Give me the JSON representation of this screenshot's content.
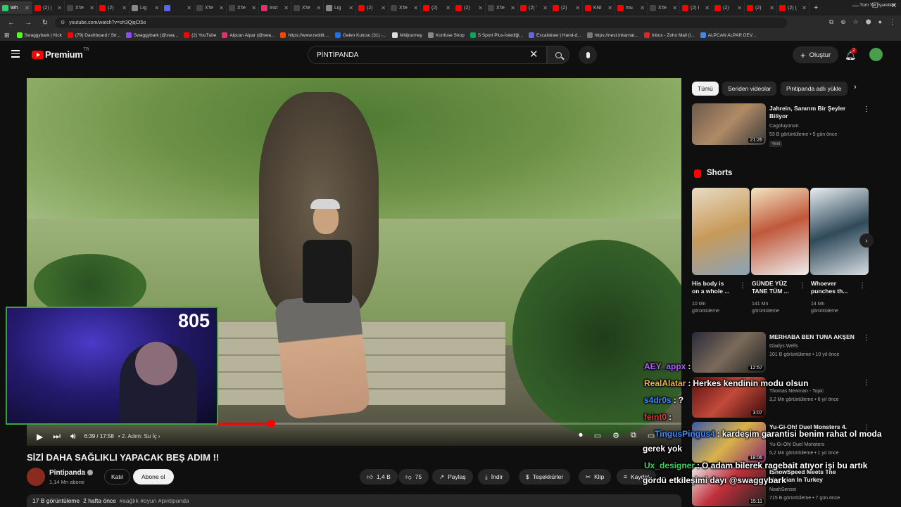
{
  "browser": {
    "tabs": [
      {
        "label": "Wh",
        "color": "#25d366"
      },
      {
        "label": "(2) (",
        "color": "#ff0000"
      },
      {
        "label": "X'te",
        "color": "#444"
      },
      {
        "label": "(2)",
        "color": "#ff0000"
      },
      {
        "label": "Lig",
        "color": "#888"
      },
      {
        "label": "",
        "color": "#5865f2"
      },
      {
        "label": "X'te",
        "color": "#444"
      },
      {
        "label": "X'te",
        "color": "#444"
      },
      {
        "label": "İnst",
        "color": "#e1306c"
      },
      {
        "label": "X'te",
        "color": "#444"
      },
      {
        "label": "Lig",
        "color": "#888"
      },
      {
        "label": "(2)",
        "color": "#ff0000"
      },
      {
        "label": "X'te",
        "color": "#444"
      },
      {
        "label": "(2)",
        "color": "#ff0000"
      },
      {
        "label": "(2)",
        "color": "#ff0000"
      },
      {
        "label": "X'te",
        "color": "#444"
      },
      {
        "label": "(2) '",
        "color": "#ff0000"
      },
      {
        "label": "(2)",
        "color": "#ff0000"
      },
      {
        "label": "KNI",
        "color": "#ff0000"
      },
      {
        "label": "mu",
        "color": "#ff0000"
      },
      {
        "label": "X'te",
        "color": "#444"
      },
      {
        "label": "(2) I",
        "color": "#ff0000"
      },
      {
        "label": "(2)",
        "color": "#ff0000"
      },
      {
        "label": "(2)",
        "color": "#ff0000"
      },
      {
        "label": "(2) (",
        "color": "#ff0000"
      }
    ],
    "new_tab": "+",
    "window_controls": [
      "—",
      "☐",
      "✕"
    ],
    "url": "youtube.com/watch?v=oh3QjqCt5o",
    "bookmarks": [
      {
        "label": "Swaggybark | Kick",
        "color": "#53fc18"
      },
      {
        "label": "(79) Dashboard / Str...",
        "color": "#ff0000"
      },
      {
        "label": "Swaggybark (@swa...",
        "color": "#9146ff"
      },
      {
        "label": "(2) YouTube",
        "color": "#ff0000"
      },
      {
        "label": "Alpcan Alpar (@swa...",
        "color": "#e1306c"
      },
      {
        "label": "https://www.reddit....",
        "color": "#ff4500"
      },
      {
        "label": "Gelen Kutusu (31) -...",
        "color": "#1a73e8"
      },
      {
        "label": "Midjourney",
        "color": "#ddd"
      },
      {
        "label": "Konfuse Shop",
        "color": "#888"
      },
      {
        "label": "S Sport Plus-İstediği...",
        "color": "#0a5"
      },
      {
        "label": "Excalidraw | Hand-d...",
        "color": "#6965db"
      },
      {
        "label": "https://nest.inkarnat...",
        "color": "#777"
      },
      {
        "label": "Inbox - Zoho Mail (i...",
        "color": "#e42527"
      },
      {
        "label": "ALPCAN ALPAR DEV...",
        "color": "#4285f4"
      }
    ],
    "all_bookmarks": "Tüm Yer İşaretleri"
  },
  "header": {
    "brand": "Premium",
    "region": "TR",
    "search_value": "PİNTİPANDA",
    "create_label": "Oluştur",
    "notifications": "2"
  },
  "player": {
    "progress": 0.373,
    "time": "6:39 / 17:58",
    "chapter": "• 2. Adım: Su İç ›"
  },
  "webcam": {
    "count": "805"
  },
  "video": {
    "title": "SİZİ DAHA SAĞLIKLI YAPACAK BEŞ ADIM !!",
    "channel": "Pintipanda",
    "subscribers": "1,14 Mn abone",
    "join_label": "Katıl",
    "subscribe_label": "Abone ol",
    "likes": "1,4 B",
    "dislikes": "75",
    "share_label": "Paylaş",
    "download_label": "İndir",
    "thanks_label": "Teşekkürler",
    "clip_label": "Klip",
    "save_label": "Kaydet",
    "views": "17 B görüntüleme",
    "age": "2 hafta önce",
    "tags": "#sağlık #oyun #pintipanda"
  },
  "sidebar": {
    "chips": [
      "Tümü",
      "Seriden videolar",
      "Pintipanda adlı yükle"
    ],
    "first_video": {
      "title_line1": "Jahrein, Sanırım Bir Şeyler",
      "title_line2": "Biliyor",
      "channel": "Cagoluyorum",
      "meta": "53 B görüntüleme • 5 gün önce",
      "badge": "Yeni",
      "duration": "21:26"
    },
    "shorts_label": "Shorts",
    "shorts": [
      {
        "line1": "His body is",
        "line2": "on a whole ...",
        "views1": "10 Mn",
        "views2": "görüntüleme"
      },
      {
        "line1": "GÜNDE YÜZ",
        "line2": "TANE TÜM ...",
        "views1": "141 Mn",
        "views2": "görüntüleme"
      },
      {
        "line1": "Whoever",
        "line2": "punches th...",
        "views1": "14 Mn",
        "views2": "görüntüleme"
      }
    ],
    "videos": [
      {
        "title": "MERHABA BEN TUNA AKŞEN",
        "channel": "Gladys Wells",
        "meta": "101 B görüntüleme • 10 yıl önce",
        "duration": "12:57"
      },
      {
        "title": "",
        "channel": "Thomas Newman - Topic",
        "meta": "3,2 Mn görüntüleme • 6 yıl önce",
        "duration": "3:07"
      },
      {
        "title": "Yu-Gi-Oh! Duel Monsters 4.",
        "channel": "Yu-Gi-Oh! Duel Monsters",
        "meta": "5,2 Mn görüntüleme • 1 yıl önce",
        "duration": "18:06"
      },
      {
        "title": "IShowSpeed Meets The",
        "subtitle": "Magician In Turkey",
        "channel": "NoahSensei",
        "meta": "715 B görüntüleme • 7 gün önce",
        "duration": "15:11"
      }
    ]
  },
  "chat": [
    {
      "user": "AEY_appx",
      "sep": ":",
      "msg": "",
      "color": "#b45cff"
    },
    {
      "user": "RealAlatar",
      "sep": ":",
      "msg": "Herkes kendinin modu olsun",
      "color": "#f0b24a"
    },
    {
      "user": "s4dr0s",
      "sep": ":",
      "msg": "?",
      "color": "#3d8bff"
    },
    {
      "user": "feint0",
      "sep": ":",
      "msg": "",
      "color": "#e03a3a"
    },
    {
      "user": "TingusPingus4",
      "sep": ":",
      "msg": "kardeşim garantisi benim rahat ol moda",
      "color": "#3d8bff"
    },
    {
      "user": "",
      "sep": "",
      "msg": "gerek yok",
      "color": "#fff"
    },
    {
      "user": "Ux_designer",
      "sep": ":",
      "msg": "O adam bilerek ragebait atıyor işi bu artık",
      "color": "#3ad35a"
    },
    {
      "user": "",
      "sep": "",
      "msg": "gördü etkileşimi dayı @swaggybark",
      "color": "#fff"
    }
  ],
  "colors": {
    "accent": "#ff0000",
    "bg": "#0f0f0f",
    "chip": "#272727"
  }
}
